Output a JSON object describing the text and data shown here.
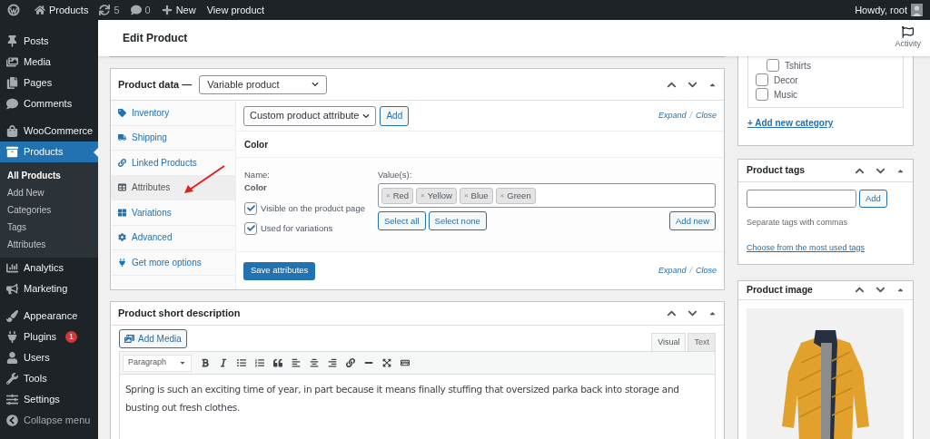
{
  "admin_bar": {
    "items": [
      {
        "kind": "logo"
      },
      {
        "kind": "home",
        "label": "Products"
      },
      {
        "kind": "updates",
        "label": "5"
      },
      {
        "kind": "comments",
        "label": "0"
      },
      {
        "kind": "new",
        "label": "New"
      },
      {
        "kind": "text",
        "label": "View product"
      }
    ],
    "greeting": "Howdy, root"
  },
  "sidebar": {
    "groups": [
      [
        {
          "kind": "pin",
          "label": "Posts",
          "selected": false
        },
        {
          "kind": "media",
          "label": "Media",
          "selected": false
        },
        {
          "kind": "pages",
          "label": "Pages",
          "selected": false
        },
        {
          "kind": "comments",
          "label": "Comments",
          "selected": false
        }
      ],
      [
        {
          "kind": "woo",
          "label": "WooCommerce",
          "selected": false
        },
        {
          "kind": "products",
          "label": "Products",
          "selected": true,
          "children": [
            {
              "label": "All Products",
              "selected": true
            },
            {
              "label": "Add New",
              "selected": false
            },
            {
              "label": "Categories",
              "selected": false
            },
            {
              "label": "Tags",
              "selected": false
            },
            {
              "label": "Attributes",
              "selected": false
            }
          ]
        },
        {
          "kind": "analytics",
          "label": "Analytics",
          "selected": false
        },
        {
          "kind": "marketing",
          "label": "Marketing",
          "selected": false
        }
      ],
      [
        {
          "kind": "appearance",
          "label": "Appearance",
          "selected": false
        },
        {
          "kind": "plugins",
          "label": "Plugins",
          "selected": false,
          "badge": "1"
        },
        {
          "kind": "users",
          "label": "Users",
          "selected": false
        },
        {
          "kind": "tools",
          "label": "Tools",
          "selected": false
        },
        {
          "kind": "settings",
          "label": "Settings",
          "selected": false
        },
        {
          "kind": "collapse",
          "label": "Collapse menu",
          "selected": false
        }
      ]
    ]
  },
  "header": {
    "title": "Edit Product",
    "activity": "Activity"
  },
  "product_data": {
    "title": "Product data —",
    "type": "Variable product",
    "tabs": [
      {
        "kind": "inventory",
        "label": "Inventory",
        "selected": false
      },
      {
        "kind": "shipping",
        "label": "Shipping",
        "selected": false
      },
      {
        "kind": "linked",
        "label": "Linked Products",
        "selected": false
      },
      {
        "kind": "attributes",
        "label": "Attributes",
        "selected": true
      },
      {
        "kind": "variations",
        "label": "Variations",
        "selected": false
      },
      {
        "kind": "advanced",
        "label": "Advanced",
        "selected": false
      },
      {
        "kind": "more",
        "label": "Get more options",
        "selected": false
      }
    ],
    "attribute_select": "Custom product attribute",
    "add_button": "Add",
    "expand": "Expand",
    "separator": "/",
    "close": "Close",
    "attribute": {
      "heading": "Color",
      "name_label": "Name:",
      "name_value": "Color",
      "checkboxes": [
        {
          "label": "Visible on the product page",
          "checked": true
        },
        {
          "label": "Used for variations",
          "checked": true
        }
      ],
      "values_label": "Value(s):",
      "values": [
        "Red",
        "Yellow",
        "Blue",
        "Green"
      ],
      "remove_mark": "×",
      "buttons": [
        "Select all",
        "Select none"
      ],
      "add_new": "Add new"
    },
    "save_button": "Save attributes",
    "expand_bottom": "Expand",
    "separator_bottom": "/",
    "close_bottom": "Close"
  },
  "short_description": {
    "title": "Product short description",
    "add_media": "Add Media",
    "editor_tabs": [
      {
        "label": "Visual",
        "selected": true
      },
      {
        "label": "Text",
        "selected": false
      }
    ],
    "format": "Paragraph",
    "content": "Spring is such an exciting time of year, in part because it means finally stuffing that oversized parka back into storage and busting out fresh clothes."
  },
  "categories": {
    "items": [
      {
        "kind": "child",
        "label": "Tshirts",
        "checked": false
      },
      {
        "kind": "top",
        "label": "Decor",
        "checked": false
      },
      {
        "kind": "top",
        "label": "Music",
        "checked": false
      }
    ],
    "add_link": "+ Add new category"
  },
  "tags": {
    "title": "Product tags",
    "add_button": "Add",
    "hint": "Separate tags with commas",
    "link": "Choose from the most used tags"
  },
  "image": {
    "title": "Product image",
    "kind": "picture"
  }
}
